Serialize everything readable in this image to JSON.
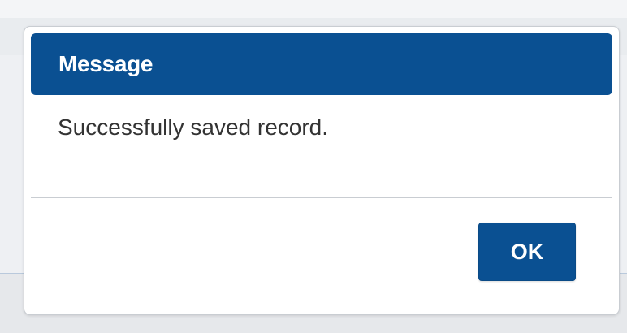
{
  "dialog": {
    "title": "Message",
    "message": "Successfully saved record.",
    "ok_label": "OK"
  },
  "colors": {
    "header": "#0a5092",
    "button": "#0a5092",
    "text": "#333333"
  }
}
